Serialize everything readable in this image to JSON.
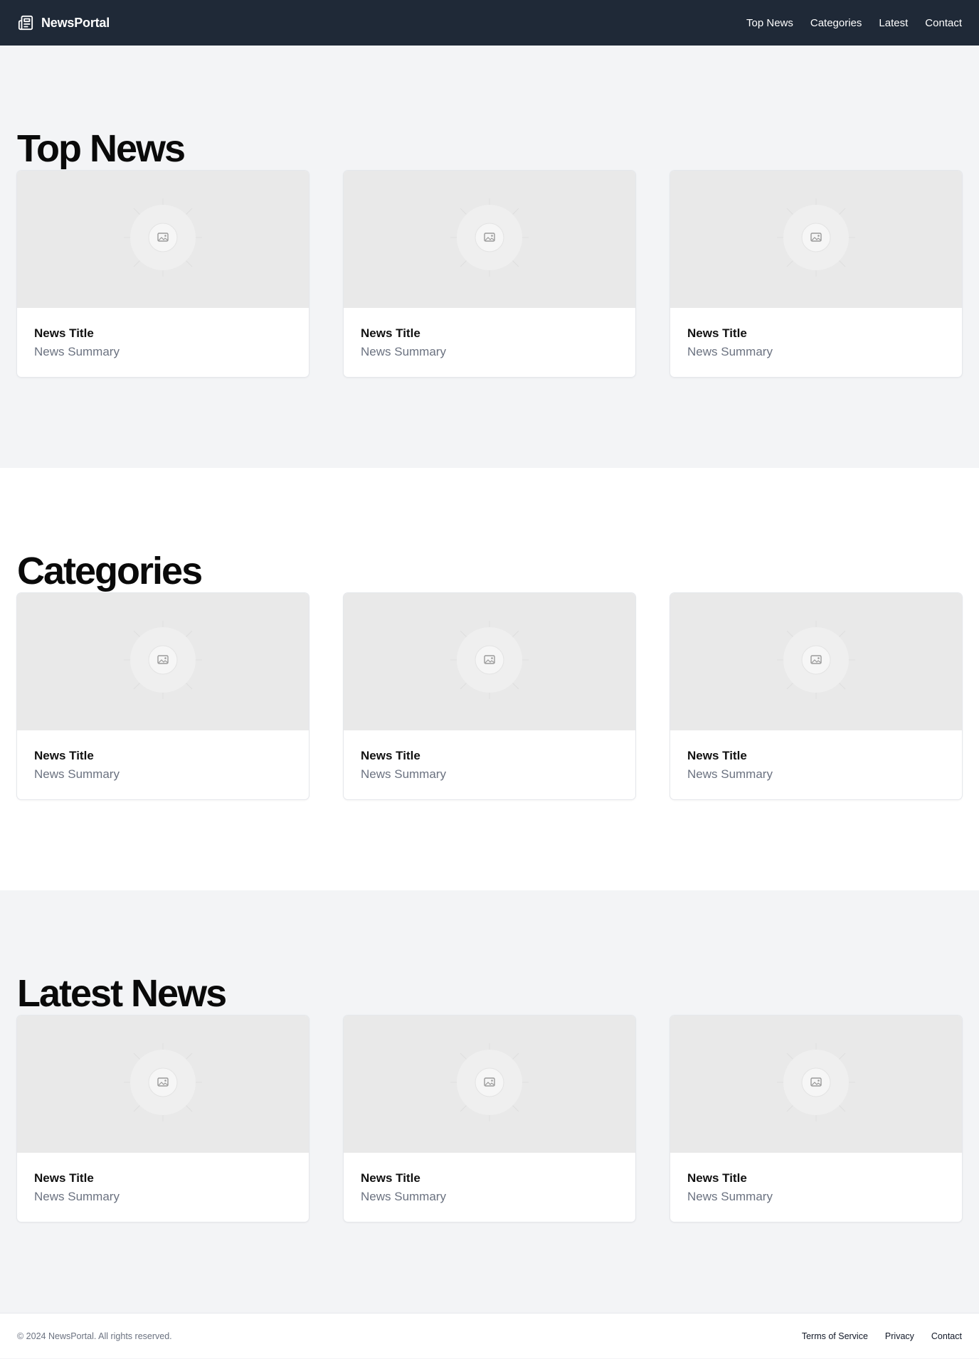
{
  "header": {
    "brand": "NewsPortal",
    "nav": [
      "Top News",
      "Categories",
      "Latest",
      "Contact"
    ]
  },
  "sections": [
    {
      "heading": "Top News",
      "cards": [
        {
          "title": "News Title",
          "summary": "News Summary"
        },
        {
          "title": "News Title",
          "summary": "News Summary"
        },
        {
          "title": "News Title",
          "summary": "News Summary"
        }
      ]
    },
    {
      "heading": "Categories",
      "cards": [
        {
          "title": "News Title",
          "summary": "News Summary"
        },
        {
          "title": "News Title",
          "summary": "News Summary"
        },
        {
          "title": "News Title",
          "summary": "News Summary"
        }
      ]
    },
    {
      "heading": "Latest News",
      "cards": [
        {
          "title": "News Title",
          "summary": "News Summary"
        },
        {
          "title": "News Title",
          "summary": "News Summary"
        },
        {
          "title": "News Title",
          "summary": "News Summary"
        }
      ]
    }
  ],
  "footer": {
    "copyright": "© 2024 NewsPortal. All rights reserved.",
    "links": [
      "Terms of Service",
      "Privacy",
      "Contact"
    ]
  },
  "colors": {
    "header_bg": "#1f2937",
    "page_bg": "#f3f4f6",
    "alt_section_bg": "#ffffff",
    "placeholder_bg": "#e9e9e9",
    "summary_text": "#6b7280"
  },
  "icons": {
    "brand": "newspaper-icon",
    "card_media": "image-placeholder-icon"
  }
}
